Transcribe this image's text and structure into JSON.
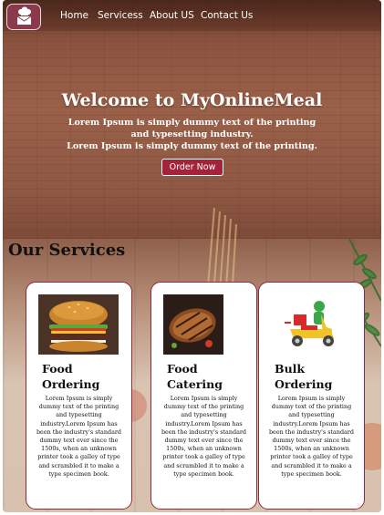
{
  "nav": {
    "items": [
      {
        "label": "Home"
      },
      {
        "label": "Servicess"
      },
      {
        "label": "About US"
      },
      {
        "label": "Contact Us"
      }
    ]
  },
  "hero": {
    "title": "Welcome to MyOnlineMeal",
    "line1": "Lorem Ipsum is simply dummy text of the printing and typesetting industry.",
    "line2": "Lorem Ipsum is simply dummy text of the printing.",
    "button_label": "Order Now"
  },
  "services": {
    "title": "Our Services",
    "cards": [
      {
        "title_line1": "Food",
        "title_line2": "Ordering",
        "image_icon": "burger-image",
        "text": "Lorem Ipsum is simply dummy text of the printing and typesetting industry.Lorem Ipsum has been the industry's standard dummy text ever since the 1500s, when an unknown printer took a galley of type and scrambled it to make a type specimen book."
      },
      {
        "title_line1": "Food",
        "title_line2": "Catering",
        "image_icon": "grilled-meat-image",
        "text": "Lorem Ipsum is simply dummy text of the printing and typesetting industry.Lorem Ipsum has been the industry's standard dummy text ever since the 1500s, when an unknown printer took a galley of type and scrambled it to make a type specimen book."
      },
      {
        "title_line1": "Bulk",
        "title_line2": "Ordering",
        "image_icon": "delivery-scooter-image",
        "text": "Lorem Ipsum is simply dummy text of the printing and typesetting industry.Lorem Ipsum has been the industry's standard dummy text ever since the 1500s, when an unknown printer took a galley of type and scrambled it to make a type specimen book."
      }
    ]
  },
  "colors": {
    "accent": "#a3233a",
    "card_border": "#8e2a3c",
    "nav_text": "#ffffff",
    "logo_bg": "#8a3a4a"
  }
}
